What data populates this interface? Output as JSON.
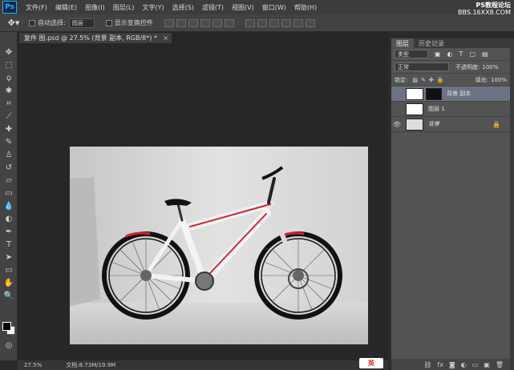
{
  "app": {
    "logo": "Ps",
    "menus": [
      "文件(F)",
      "编辑(E)",
      "图像(I)",
      "图层(L)",
      "文字(Y)",
      "选择(S)",
      "滤镜(T)",
      "视图(V)",
      "窗口(W)",
      "帮助(H)"
    ],
    "watermark_line1": "PS教程论坛",
    "watermark_line2": "BBS.16XX8.COM"
  },
  "options": {
    "auto_select_label": "自动选择:",
    "auto_select_value": "图层",
    "show_transform_label": "显示变换控件"
  },
  "document": {
    "tab_title": "复件 图.psd @ 27.5% (背景 副本, RGB/8*) *",
    "close_glyph": "×"
  },
  "status": {
    "zoom": "27.5%",
    "doc_info": "文档:8.73M/19.9M"
  },
  "panel": {
    "tabs": [
      "图层",
      "历史记录"
    ],
    "filter_label": "类型",
    "blend_mode": "正常",
    "opacity_label": "不透明度:",
    "opacity_value": "100%",
    "lock_label": "锁定:",
    "fill_label": "填充:",
    "fill_value": "100%",
    "layers": [
      {
        "name": "背景 副本",
        "selected": true
      },
      {
        "name": "图层 1",
        "selected": false
      },
      {
        "name": "背景",
        "selected": false
      }
    ]
  },
  "ime": {
    "label": "英"
  },
  "colors": {
    "accent": "#31a8ff",
    "selected_layer": "#6b7384",
    "bike_red": "#d8202e"
  }
}
